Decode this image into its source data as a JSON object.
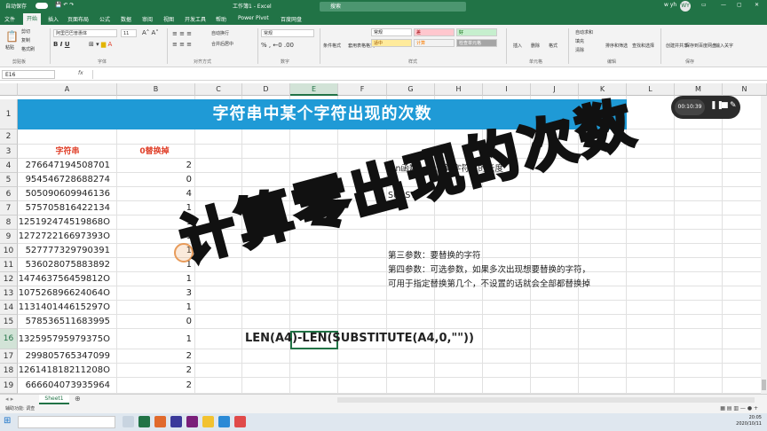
{
  "window": {
    "title": "工作簿1 - Excel",
    "autosave": "自动保存",
    "search": "搜索",
    "user": "w yh",
    "user_initials": "WY"
  },
  "tabs": [
    "文件",
    "开始",
    "插入",
    "页面布局",
    "公式",
    "数据",
    "审阅",
    "视图",
    "开发工具",
    "帮助",
    "Power Pivot",
    "百度网盘"
  ],
  "ribbon": {
    "paste": "粘贴",
    "cut": "剪切",
    "copy": "复制",
    "format_painter": "格式刷",
    "clipboard": "剪贴板",
    "font_name": "阿里巴巴普惠体",
    "font_size": "11",
    "font_group": "字体",
    "wrap": "自动换行",
    "merge": "合并后居中",
    "align_group": "对齐方式",
    "number_format": "常规",
    "number_group": "数字",
    "cond_format": "条件格式",
    "table_format": "套用表格格式",
    "styles": [
      "常规",
      "差",
      "好",
      "适中",
      "计算",
      "检查单元格"
    ],
    "styles_group": "样式",
    "insert": "插入",
    "delete": "删除",
    "format": "格式",
    "cells_group": "单元格",
    "autosum": "自动求和",
    "fill": "填充",
    "clear": "清除",
    "sort_filter": "排序和筛选",
    "find_select": "查找和选择",
    "edit_group": "编辑",
    "share": "创建并共享",
    "baidu": "保存到百度网盘",
    "save_group": "保存",
    "input": "输入关字"
  },
  "formula_bar": {
    "name_box": "E16",
    "fx": "fx"
  },
  "columns": [
    "A",
    "B",
    "C",
    "D",
    "E",
    "F",
    "G",
    "H",
    "I",
    "J",
    "K",
    "L",
    "M",
    "N"
  ],
  "rows": [
    "1",
    "2",
    "3",
    "4",
    "5",
    "6",
    "7",
    "8",
    "9",
    "10",
    "11",
    "12",
    "13",
    "14",
    "15",
    "16",
    "17",
    "18",
    "19"
  ],
  "banner": "字符串中某个字符出现的次数",
  "headers": {
    "a": "字符串",
    "b": "0替换掉"
  },
  "data": [
    {
      "a": "276647194508701",
      "b": "2"
    },
    {
      "a": "954546728688274",
      "b": "0"
    },
    {
      "a": "505090609946136",
      "b": "4"
    },
    {
      "a": "575705816422134",
      "b": "1"
    },
    {
      "a": "125192474519868O",
      "b": "1"
    },
    {
      "a": "127272216697393O",
      "b": "1"
    },
    {
      "a": "527777329790391",
      "b": "1"
    },
    {
      "a": "536028075883892",
      "b": "1"
    },
    {
      "a": "147463756459812O",
      "b": "1"
    },
    {
      "a": "107526896624064O",
      "b": "3"
    },
    {
      "a": "113140144615297O",
      "b": "1"
    },
    {
      "a": "578536511683995",
      "b": "0"
    },
    {
      "a": "132595795979375O",
      "b": "1"
    },
    {
      "a": "299805765347099",
      "b": "2"
    },
    {
      "a": "126141818211208O",
      "b": "2"
    },
    {
      "a": "666604073935964",
      "b": "2"
    }
  ],
  "notes": {
    "len": "len函数",
    "len_desc": "计算字符串的长度",
    "subst": "SUBST",
    "third": "第三参数：要替换的字符",
    "fourth": "第四参数：可选参数，如果多次出现想要替换的字符，",
    "fourth2": "可用于指定替换第几个，不设置的话就会全部都替换掉"
  },
  "formula": "LEN(A4)-LEN(SUBSTITUTE(A4,0,\"\"))",
  "overlay": "计算零出现的次数",
  "recorder": {
    "time": "00:10:39"
  },
  "sheet": {
    "name": "Sheet1",
    "status": "辅助功能: 调查"
  },
  "clock": {
    "time": "20:05",
    "date": "2020/10/11"
  }
}
